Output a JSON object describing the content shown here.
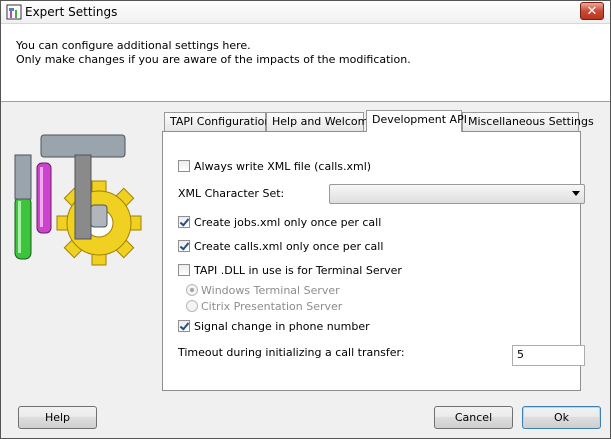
{
  "window": {
    "title": "Expert Settings",
    "close_glyph": "✕"
  },
  "header": {
    "line1": "You can configure additional settings here.",
    "line2": "Only make changes if you are aware of the impacts of the modification."
  },
  "tabs": [
    {
      "label": "TAPI Configuration",
      "active": false
    },
    {
      "label": "Help and Welcome",
      "active": false
    },
    {
      "label": "Development API",
      "active": true
    },
    {
      "label": "Miscellaneous Settings",
      "active": false
    }
  ],
  "panel": {
    "always_write_xml": {
      "label": "Always write XML file (calls.xml)",
      "checked": false
    },
    "xml_charset": {
      "label": "XML Character Set:",
      "value": ""
    },
    "create_jobs_once": {
      "label": "Create jobs.xml only once per call",
      "checked": true
    },
    "create_calls_once": {
      "label": "Create calls.xml only once per call",
      "checked": true
    },
    "tapi_terminal_server": {
      "label": "TAPI .DLL in use is for Terminal Server",
      "checked": false
    },
    "windows_terminal_server": {
      "label": "Windows Terminal Server",
      "selected": true,
      "enabled": false
    },
    "citrix_presentation_server": {
      "label": "Citrix Presentation Server",
      "selected": false,
      "enabled": false
    },
    "signal_change": {
      "label": "Signal change in phone number",
      "checked": true
    },
    "timeout": {
      "label": "Timeout during initializing a call transfer:",
      "value": "5"
    }
  },
  "buttons": {
    "help": "Help",
    "cancel": "Cancel",
    "ok": "Ok"
  },
  "colors": {
    "hammer_handle": "#8a8a8a",
    "pink_handle": "#cc44cc",
    "green_handle": "#3cc43c",
    "gear": "#f0d020",
    "default_button_border": "#3c7fb1"
  },
  "icons": {
    "title": "app-tool-icon",
    "art": "tools-and-gear-illustration",
    "close": "close-icon",
    "dropdown": "chevron-down-icon"
  }
}
